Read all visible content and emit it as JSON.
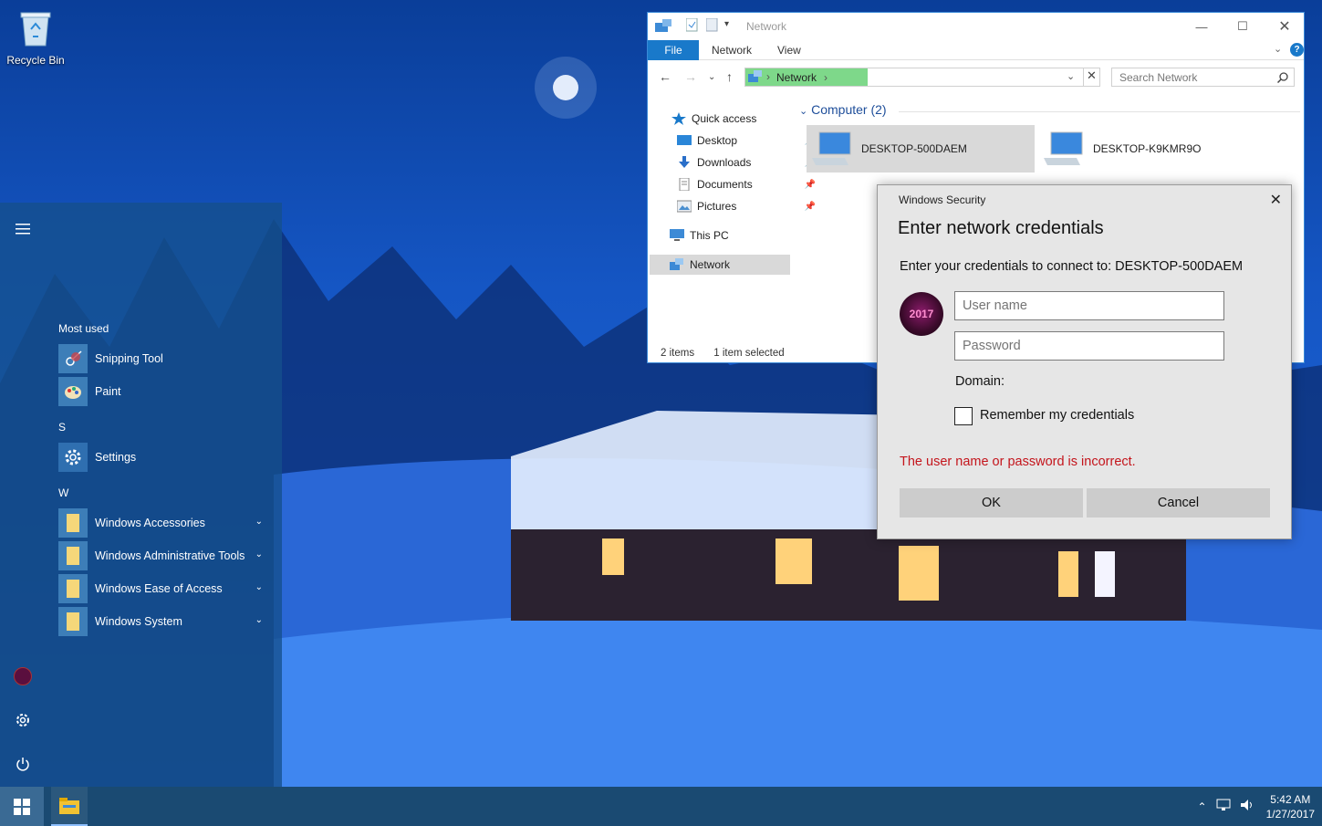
{
  "desktop": {
    "recycle_bin_label": "Recycle Bin"
  },
  "start_menu": {
    "most_used_label": "Most used",
    "most_used": [
      {
        "label": "Snipping Tool",
        "icon": "snipping-tool-icon"
      },
      {
        "label": "Paint",
        "icon": "paint-icon"
      }
    ],
    "groups": [
      {
        "letter": "S",
        "items": [
          {
            "label": "Settings",
            "icon": "gear-icon"
          }
        ]
      },
      {
        "letter": "W",
        "items": [
          {
            "label": "Windows Accessories",
            "icon": "folder-icon"
          },
          {
            "label": "Windows Administrative Tools",
            "icon": "folder-icon"
          },
          {
            "label": "Windows Ease of Access",
            "icon": "folder-icon"
          },
          {
            "label": "Windows System",
            "icon": "folder-icon"
          }
        ]
      }
    ]
  },
  "taskbar": {
    "time": "5:42 AM",
    "date": "1/27/2017"
  },
  "explorer": {
    "title": "Network",
    "ribbon_tabs": [
      "File",
      "Network",
      "View"
    ],
    "address_segment": "Network",
    "search_placeholder": "Search Network",
    "nav": {
      "quick_access": "Quick access",
      "pinned": [
        "Desktop",
        "Downloads",
        "Documents",
        "Pictures"
      ],
      "this_pc": "This PC",
      "network": "Network"
    },
    "group_header": "Computer (2)",
    "computers": [
      "DESKTOP-500DAEM",
      "DESKTOP-K9KMR9O"
    ],
    "status_items": "2 items",
    "status_selected": "1 item selected"
  },
  "dialog": {
    "window_title": "Windows Security",
    "heading": "Enter network credentials",
    "message": "Enter your credentials to connect to: DESKTOP-500DAEM",
    "avatar_text": "2017",
    "username_placeholder": "User name",
    "password_placeholder": "Password",
    "domain_label": "Domain:",
    "remember_label": "Remember my credentials",
    "remember_checked": false,
    "error": "The user name or password is incorrect.",
    "ok_label": "OK",
    "cancel_label": "Cancel",
    "error_color": "#c4151c"
  }
}
